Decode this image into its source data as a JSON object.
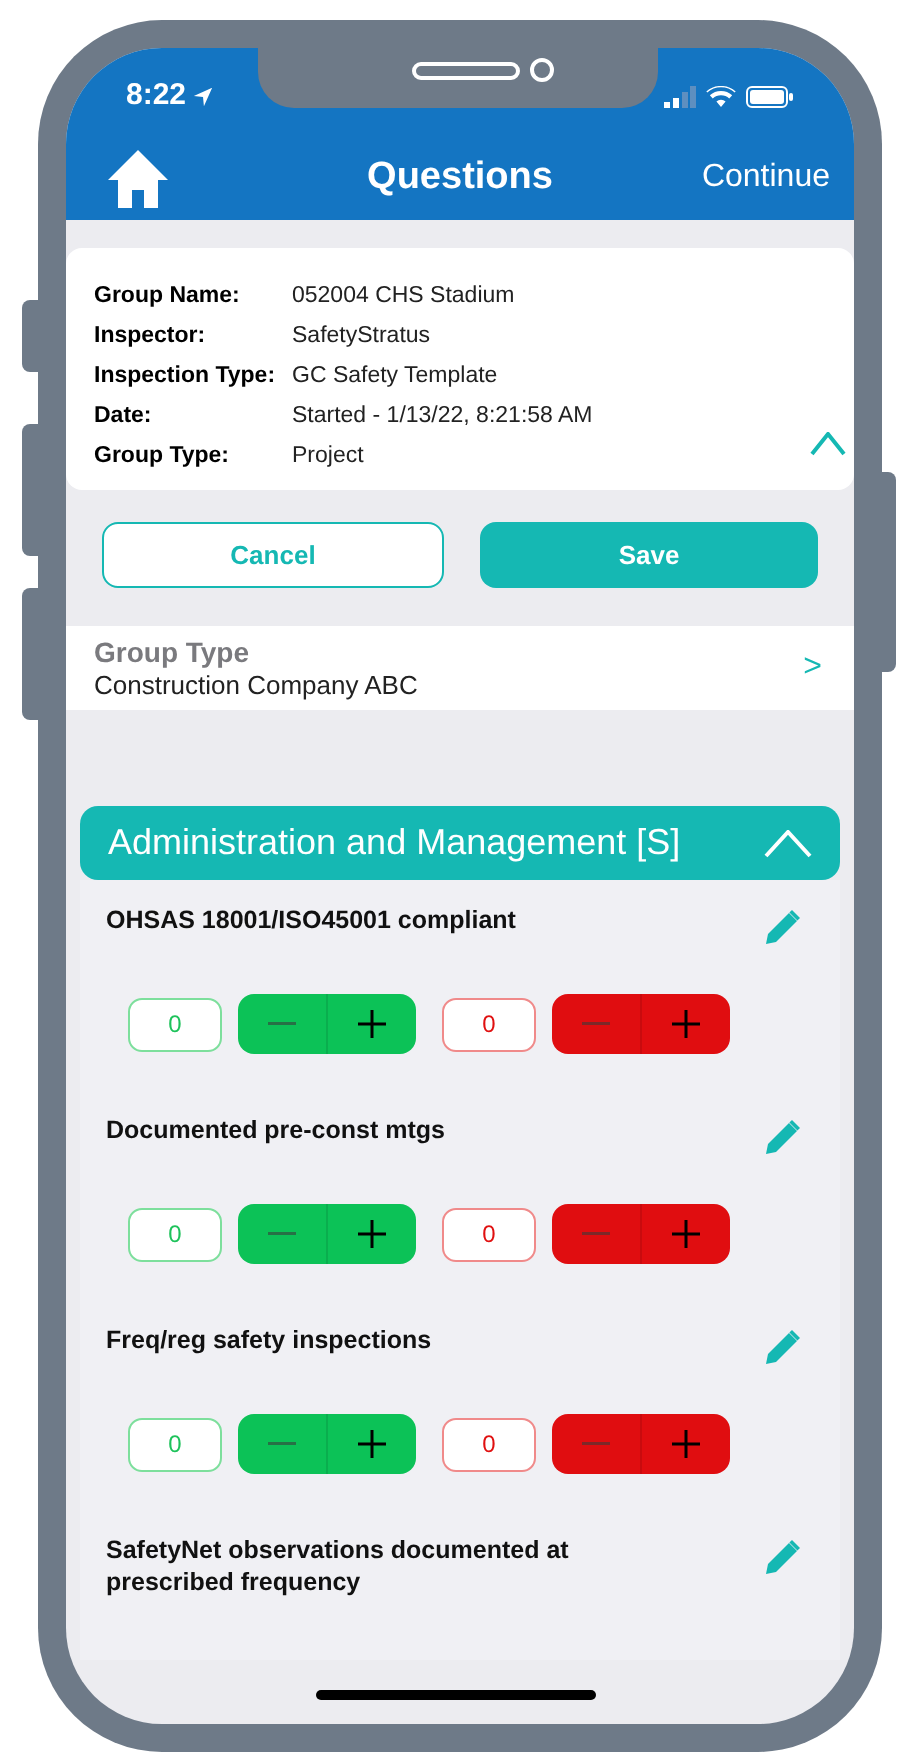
{
  "status_bar": {
    "time": "8:22"
  },
  "nav": {
    "title": "Questions",
    "action": "Continue"
  },
  "info": {
    "expanded": true,
    "rows": [
      {
        "label": "Group Name:",
        "value": "052004 CHS Stadium"
      },
      {
        "label": "Inspector:",
        "value": "SafetyStratus"
      },
      {
        "label": "Inspection Type:",
        "value": "GC Safety Template"
      },
      {
        "label": "Date:",
        "value": "Started - 1/13/22, 8:21:58 AM"
      },
      {
        "label": "Group Type:",
        "value": "Project"
      }
    ]
  },
  "buttons": [
    {
      "label": "Cancel",
      "kind": "outline"
    },
    {
      "label": "Save",
      "kind": "filled"
    }
  ],
  "group_type": {
    "label": "Group Type",
    "value": "Construction Company ABC",
    "arrow": ">"
  },
  "section": {
    "title": "Administration and Management [S]",
    "expanded": true,
    "questions": [
      {
        "text": "OHSAS 18001/ISO45001 compliant",
        "counters": {
          "positive": "0",
          "negative": "0"
        }
      },
      {
        "text": "Documented pre-const mtgs",
        "counters": {
          "positive": "0",
          "negative": "0"
        }
      },
      {
        "text": "Freq/reg safety inspections",
        "counters": {
          "positive": "0",
          "negative": "0"
        }
      },
      {
        "text": "SafetyNet observations documented at prescribed frequency"
      }
    ]
  }
}
